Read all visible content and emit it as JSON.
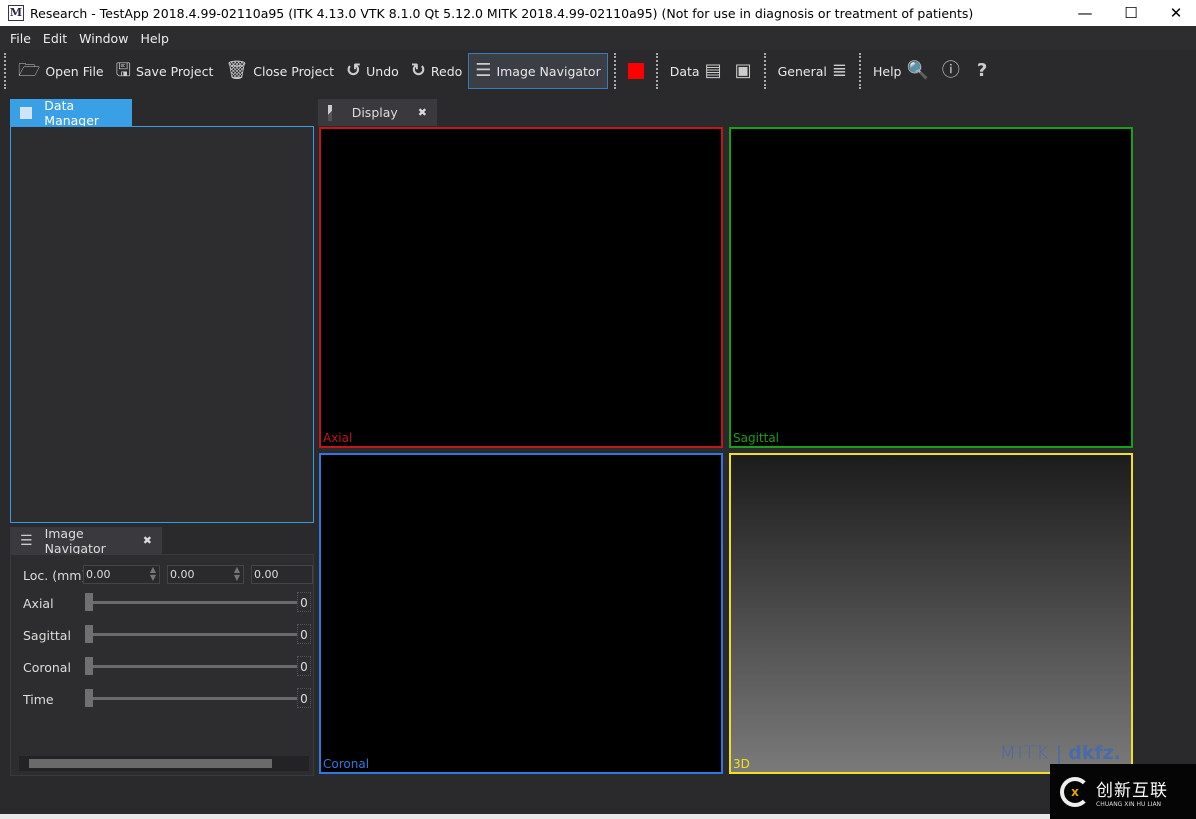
{
  "window": {
    "title": "Research - TestApp 2018.4.99-02110a95 (ITK 4.13.0  VTK 8.1.0 Qt 5.12.0 MITK 2018.4.99-02110a95) (Not for use in diagnosis or treatment of patients)",
    "logo": "M",
    "minimize": "—",
    "maximize": "☐",
    "close": "✕"
  },
  "menu": [
    {
      "label": "File"
    },
    {
      "label": "Edit"
    },
    {
      "label": "Window"
    },
    {
      "label": "Help"
    }
  ],
  "toolbar": {
    "open_file": "Open File",
    "save_project": "Save Project",
    "close_project": "Close Project",
    "undo": "Undo",
    "redo": "Redo",
    "image_navigator": "Image Navigator",
    "data": "Data",
    "general": "General",
    "help": "Help",
    "record_color": "#ff0000"
  },
  "data_manager": {
    "tab": "Data Manager"
  },
  "image_navigator": {
    "tab": "Image Navigator",
    "close": "✖",
    "loc_label": "Loc. (mm)",
    "loc": [
      "0.00",
      "0.00",
      "0.00"
    ],
    "sliders": [
      {
        "label": "Axial",
        "value": "0"
      },
      {
        "label": "Sagittal",
        "value": "0"
      },
      {
        "label": "Coronal",
        "value": "0"
      },
      {
        "label": "Time",
        "value": "0"
      }
    ]
  },
  "display": {
    "tab": "Display",
    "close": "✖",
    "views": [
      {
        "label": "Axial",
        "color": "#c0161c"
      },
      {
        "label": "Sagittal",
        "color": "#18a018"
      },
      {
        "label": "Coronal",
        "color": "#2c7ae0"
      },
      {
        "label": "3D",
        "color": "#f0e020"
      }
    ],
    "logo_left": "MITK",
    "logo_right": "dkfz."
  },
  "watermark": {
    "title": "创新互联",
    "subtitle": "CHUANG XIN HU LIAN"
  }
}
